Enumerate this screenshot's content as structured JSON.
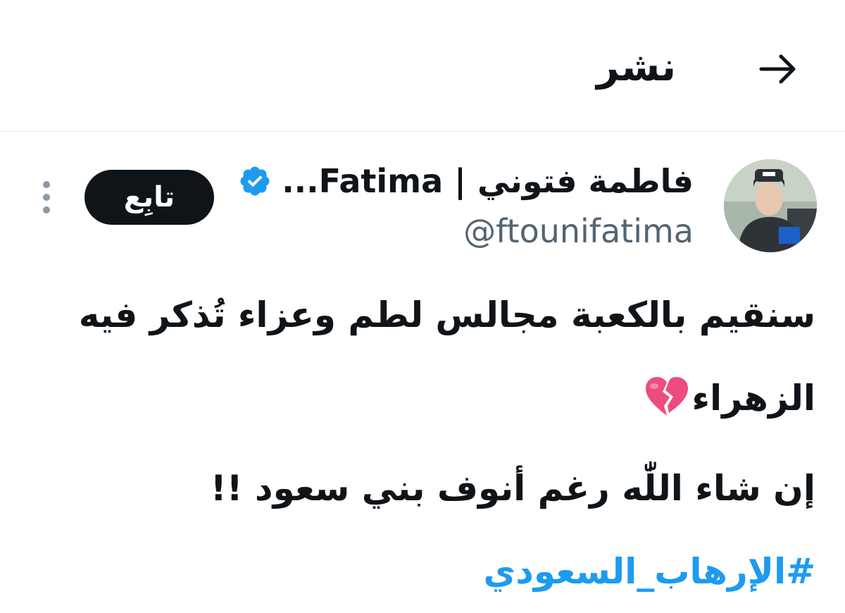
{
  "header": {
    "title": "نشر",
    "back_icon": "arrow-right-icon"
  },
  "author": {
    "name": "فاطمة فتوني | Fatima...",
    "handle": "@ftounifatima",
    "verified": true,
    "verified_color": "#1d9bf0"
  },
  "actions": {
    "follow_label": "تابِع",
    "more_icon": "more-vertical-icon"
  },
  "tweet": {
    "line1": "سنقيم بالكعبة مجالس لطم وعزاء تُذكر فيه",
    "line2": "الزهراء",
    "line2_emoji": "broken-heart-icon",
    "line3": "إن شاء اللّٰه رغم أنوف بني سعود !!",
    "hashtag": "#الإرهاب_السعودي"
  },
  "colors": {
    "link": "#1d9bf0",
    "text": "#0f1419",
    "secondary": "#536471"
  }
}
